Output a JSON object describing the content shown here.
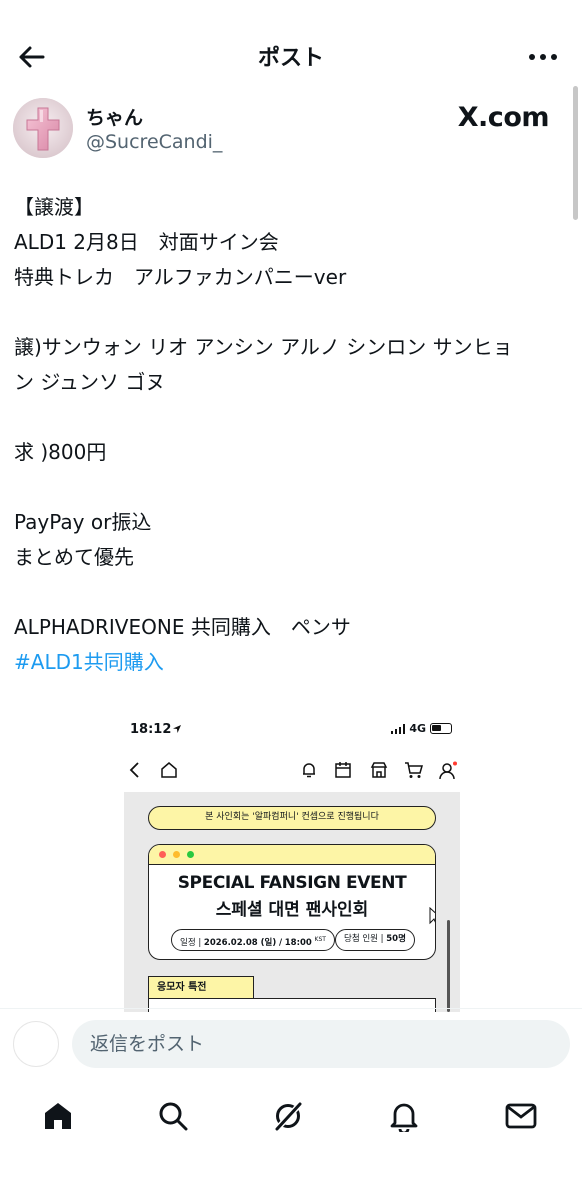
{
  "header": {
    "title": "ポスト"
  },
  "author": {
    "display_name": "ちゃん",
    "handle": "@SucreCandi_",
    "brand": "X.com"
  },
  "post": {
    "lines_1": [
      "【譲渡】",
      "ALD1 2月8日　対面サイン会",
      "特典トレカ　アルファカンパニーver"
    ],
    "lines_2": [
      "譲)サンウォン リオ アンシン アルノ シンロン サンヒョ",
      "ン ジュンソ  ゴヌ"
    ],
    "lines_3": [
      "求 )800円"
    ],
    "lines_4": [
      "PayPay or振込",
      "まとめて優先"
    ],
    "lines_5": [
      "ALPHADRIVEONE 共同購入　ペンサ"
    ],
    "hashtag": "#ALD1共同購入"
  },
  "embedded_screenshot": {
    "status_time": "18:12",
    "status_network": "4G",
    "notice": "본 사인회는 '알파컴퍼니' 컨셉으로 진행됩니다",
    "event_title_en": "SPECIAL FANSIGN EVENT",
    "event_title_ko": "스페셜 대면 팬사인회",
    "schedule_label": "일정 |",
    "schedule_date": "2026.02.08 (일)",
    "schedule_sep": "/",
    "schedule_time": "18:00",
    "schedule_tz": "KST",
    "winners_label": "당첨 인원 |",
    "winners_count": "50명",
    "tab_label": "응모자 특전",
    "dot_colors": [
      "#ff5f57",
      "#febc2e",
      "#28c840"
    ]
  },
  "reply": {
    "placeholder": "返信をポスト"
  },
  "nav": {
    "items": [
      "home-icon",
      "search-icon",
      "grok-icon",
      "notifications-icon",
      "messages-icon"
    ]
  }
}
